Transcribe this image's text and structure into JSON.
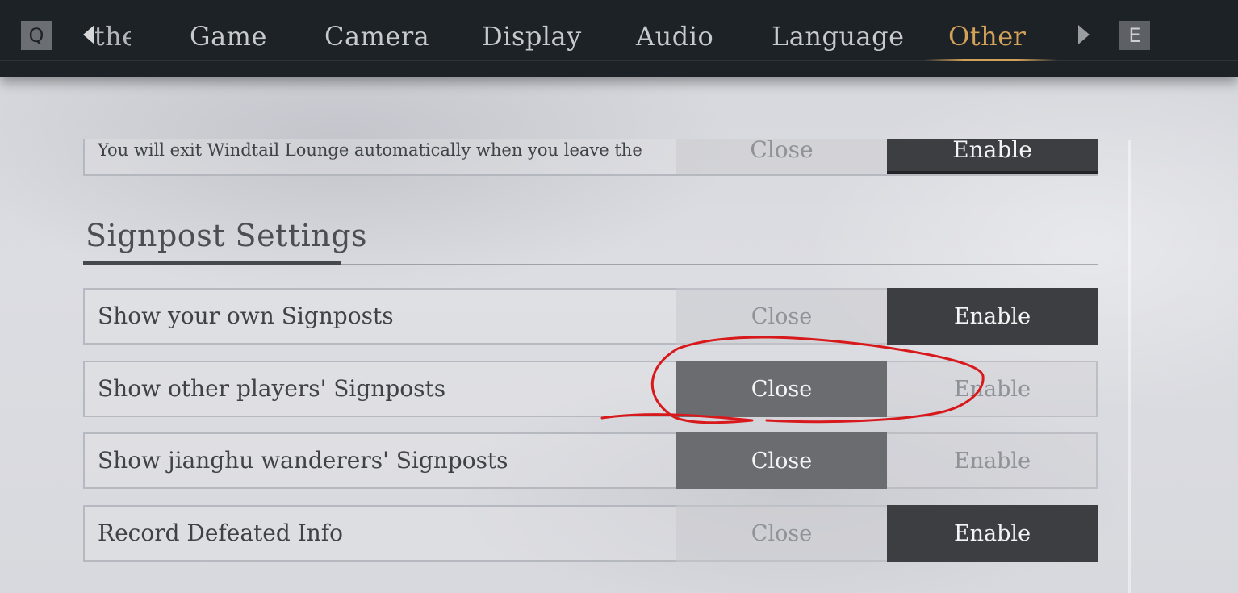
{
  "tabs": {
    "prev_key": "Q",
    "next_key": "E",
    "partial_label": "Other",
    "items": [
      "Game",
      "Camera",
      "Display",
      "Audio",
      "Language",
      "Other"
    ],
    "active": "Other",
    "active_color": "#d3a159"
  },
  "rows": {
    "lounge": {
      "label": "You will exit Windtail Lounge automatically when you leave the",
      "close": "Close",
      "enable": "Enable",
      "selected": "Enable"
    },
    "own_signposts": {
      "label": "Show your own Signposts",
      "close": "Close",
      "enable": "Enable",
      "selected": "Enable"
    },
    "other_signposts": {
      "label": "Show other players' Signposts",
      "close": "Close",
      "enable": "Enable",
      "selected": "Close"
    },
    "wanderer_signposts": {
      "label": "Show jianghu wanderers' Signposts",
      "close": "Close",
      "enable": "Enable",
      "selected": "Close"
    },
    "defeated_info": {
      "label": "Record Defeated Info",
      "close": "Close",
      "enable": "Enable",
      "selected": "Enable"
    }
  },
  "section": {
    "title": "Signpost Settings"
  },
  "annotation_color": "#d8191c"
}
